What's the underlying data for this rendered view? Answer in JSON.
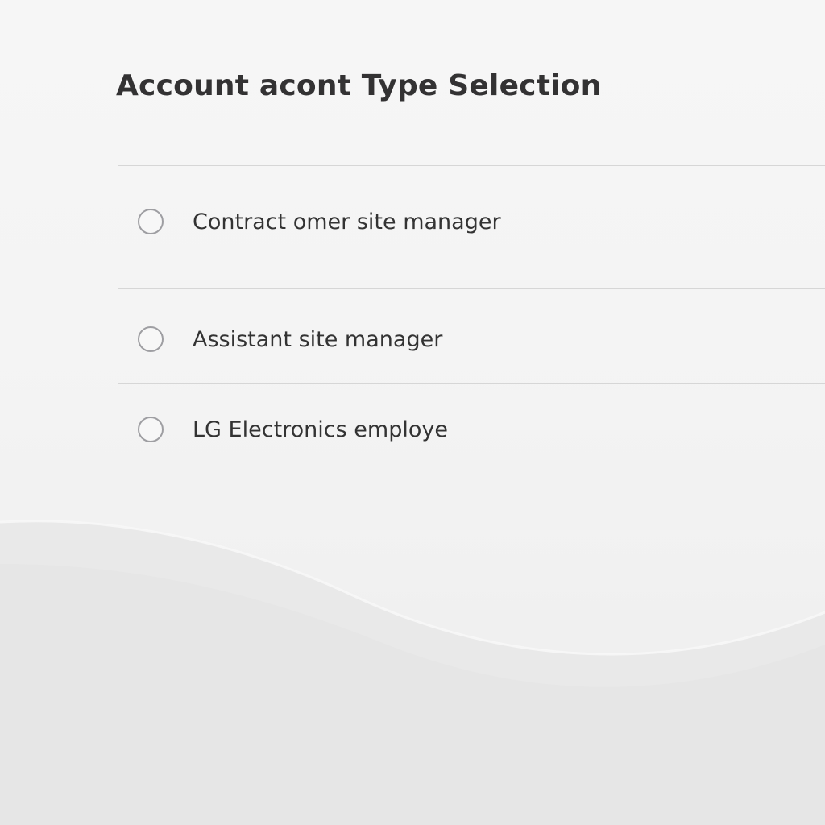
{
  "form": {
    "title": "Account acont Type Selection",
    "options": [
      {
        "label": "Contract omer site manager",
        "selected": false
      },
      {
        "label": "Assistant site manager",
        "selected": false
      },
      {
        "label": "LG Electronics employe",
        "selected": false
      }
    ]
  },
  "colors": {
    "background": "#f4f4f4",
    "title_text": "#333233",
    "option_text": "#333333",
    "divider": "#d6d6d6",
    "radio_border": "#9e9ea2"
  }
}
